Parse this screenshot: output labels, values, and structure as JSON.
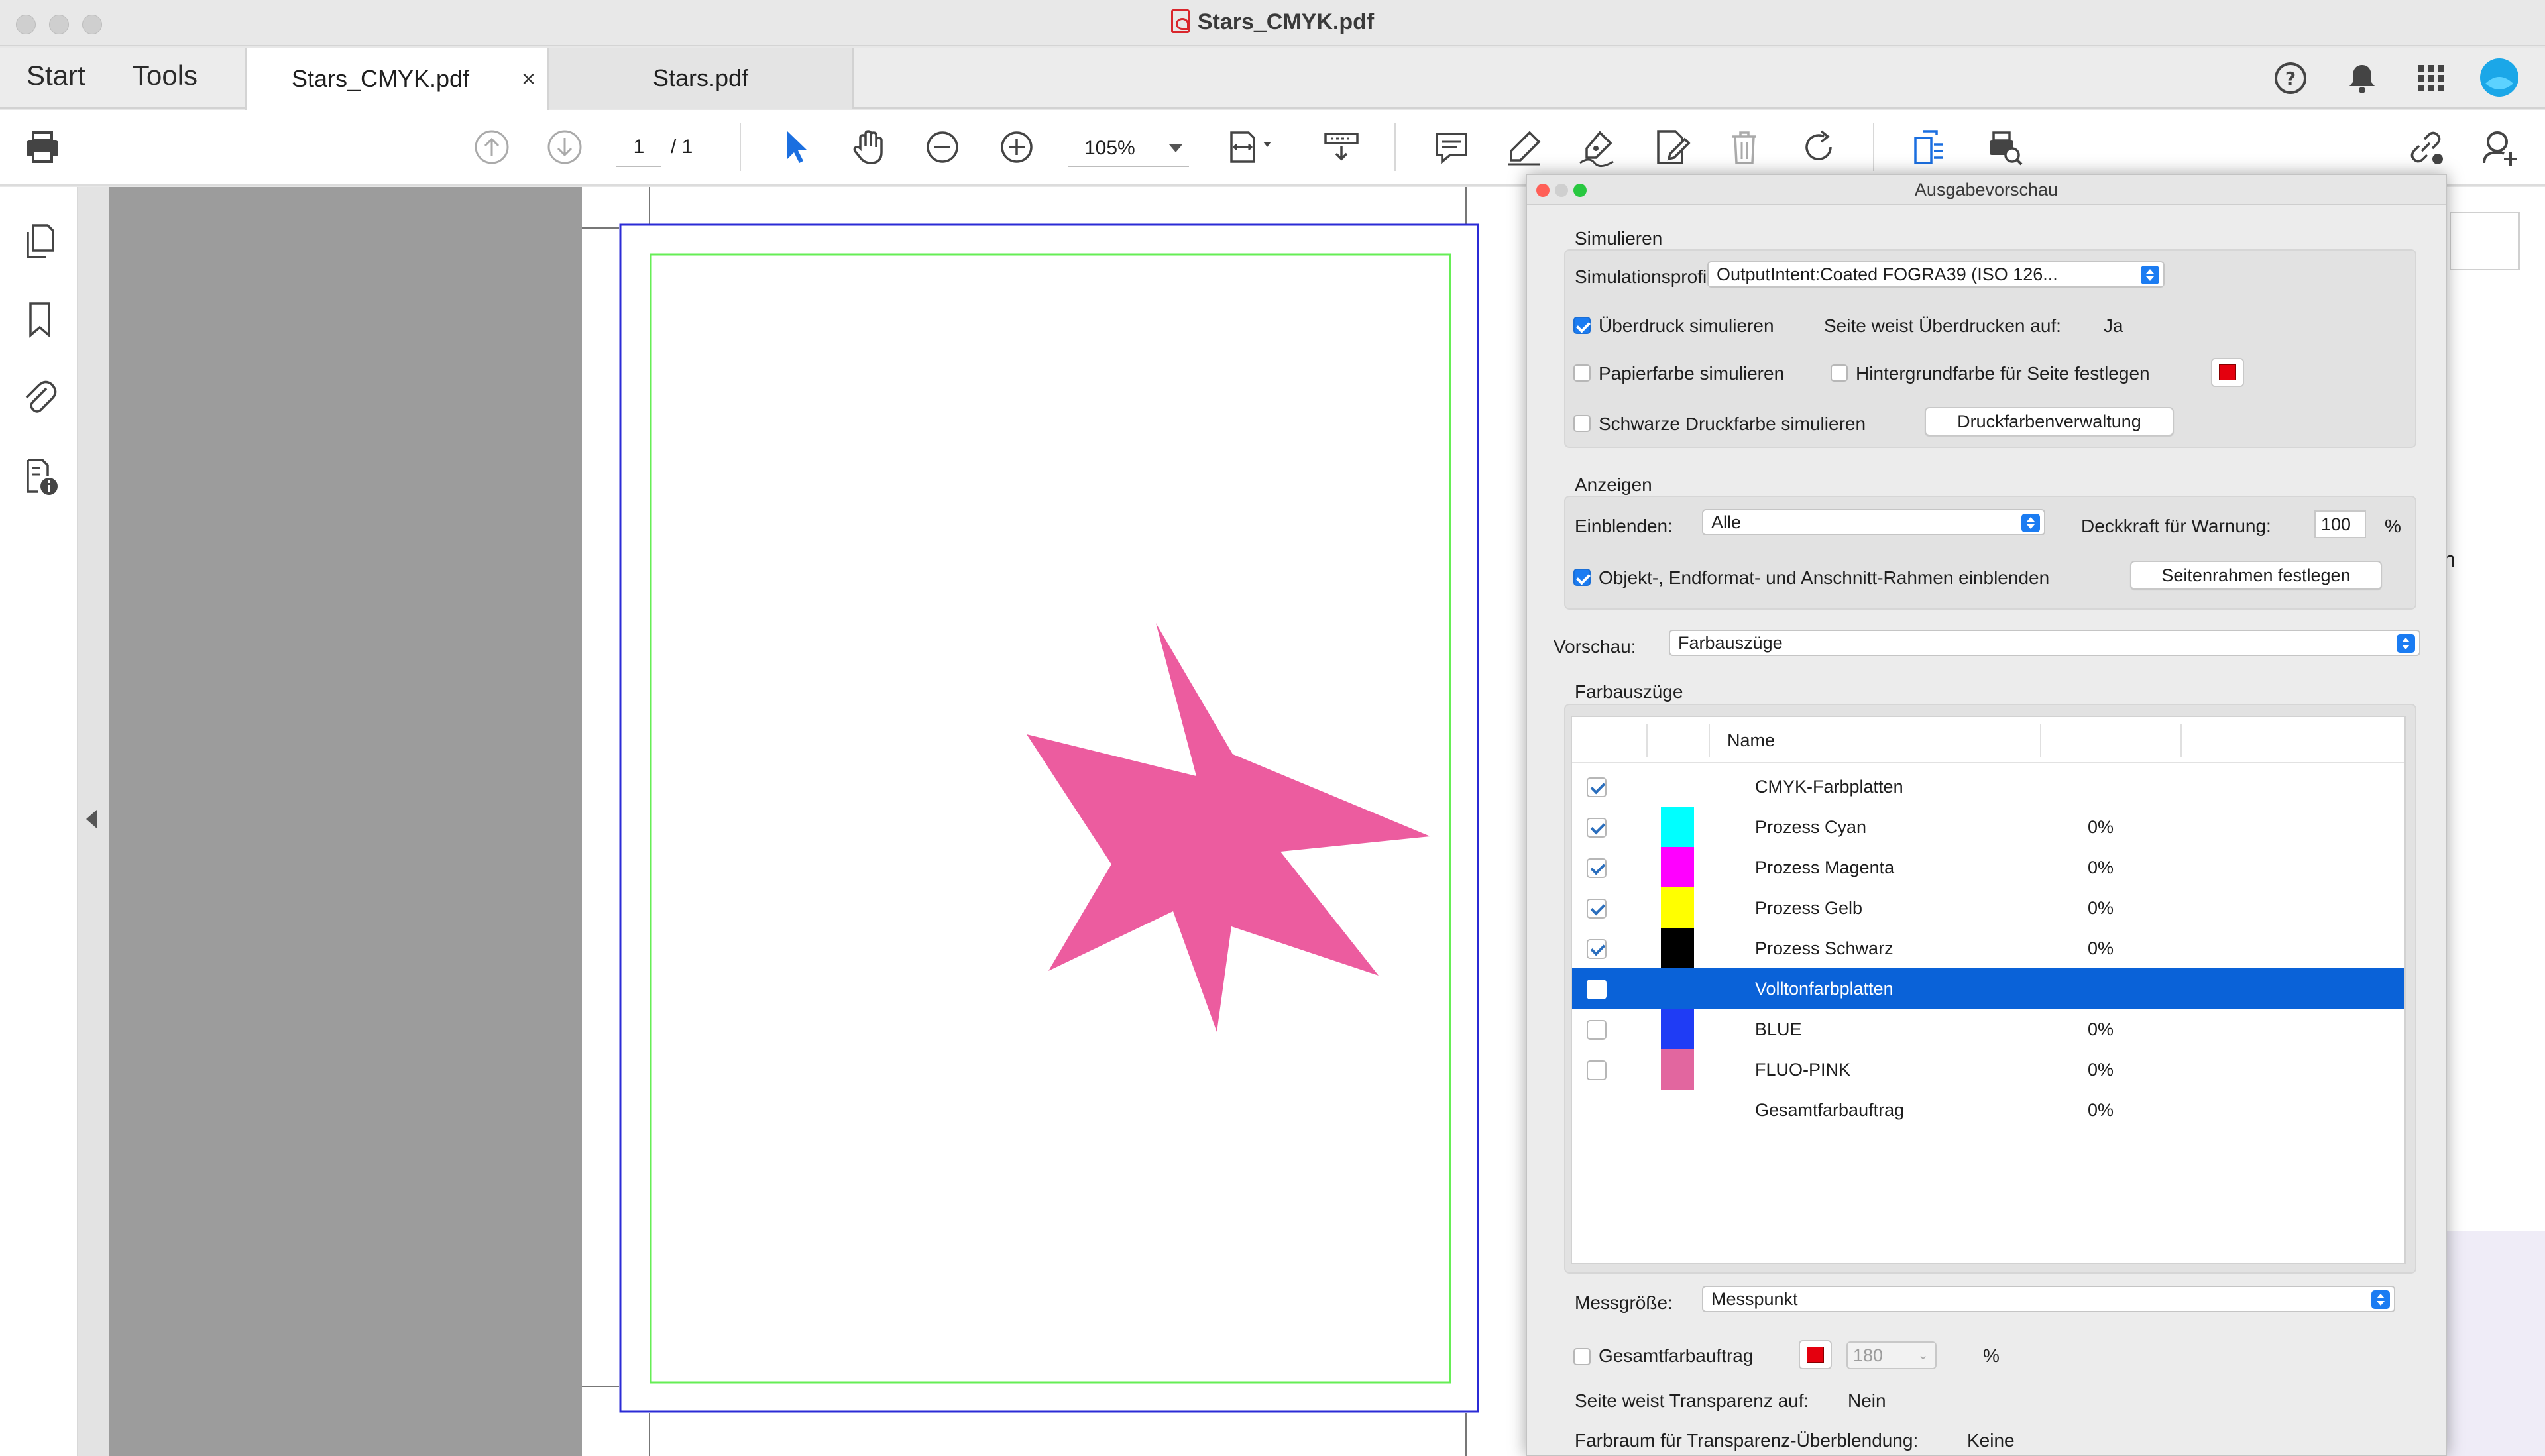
{
  "window": {
    "title": "Stars_CMYK.pdf"
  },
  "nav": {
    "start": "Start",
    "tools": "Tools"
  },
  "tabs": [
    {
      "label": "Stars_CMYK.pdf",
      "active": true,
      "close": "×"
    },
    {
      "label": "Stars.pdf",
      "active": false
    }
  ],
  "toolbar": {
    "page_current": "1",
    "page_total": "/ 1",
    "zoom": "105%"
  },
  "colors": {
    "accent": "#1b7cf2",
    "selection": "#0a62d8",
    "star": "#ec5c9f",
    "trim_box": "#2b2bd6",
    "bleed_box": "#66ee55"
  },
  "panel": {
    "title": "Ausgabevorschau",
    "simulieren": {
      "heading": "Simulieren",
      "profile_label": "Simulationsprofil:",
      "profile_value": "OutputIntent:Coated FOGRA39 (ISO 126...",
      "overprint": {
        "label": "Überdruck simulieren",
        "checked": true
      },
      "overprint_info_label": "Seite weist Überdrucken auf:",
      "overprint_info_value": "Ja",
      "paper": {
        "label": "Papierfarbe simulieren",
        "checked": false
      },
      "background": {
        "label": "Hintergrundfarbe für Seite festlegen",
        "checked": false
      },
      "black_ink": {
        "label": "Schwarze Druckfarbe simulieren",
        "checked": false
      },
      "ink_manager_button": "Druckfarbenverwaltung"
    },
    "anzeigen": {
      "heading": "Anzeigen",
      "show_label": "Einblenden:",
      "show_value": "Alle",
      "opacity_label": "Deckkraft für Warnung:",
      "opacity_value": "100",
      "opacity_unit": "%",
      "boxes": {
        "label": "Objekt-, Endformat- und Anschnitt-Rahmen einblenden",
        "checked": true
      },
      "page_boxes_button": "Seitenrahmen festlegen"
    },
    "vorschau": {
      "label": "Vorschau:",
      "value": "Farbauszüge"
    },
    "farbauszuege": {
      "heading": "Farbauszüge",
      "column_name": "Name",
      "rows": [
        {
          "name": "CMYK-Farbplatten",
          "value": "",
          "checked": true,
          "swatch": "",
          "selected": false
        },
        {
          "name": "Prozess Cyan",
          "value": "0%",
          "checked": true,
          "swatch": "#00ffff",
          "selected": false
        },
        {
          "name": "Prozess Magenta",
          "value": "0%",
          "checked": true,
          "swatch": "#ff00ff",
          "selected": false
        },
        {
          "name": "Prozess Gelb",
          "value": "0%",
          "checked": true,
          "swatch": "#ffff00",
          "selected": false
        },
        {
          "name": "Prozess Schwarz",
          "value": "0%",
          "checked": true,
          "swatch": "#000000",
          "selected": false
        },
        {
          "name": "Volltonfarbplatten",
          "value": "",
          "checked": false,
          "swatch": "",
          "selected": true
        },
        {
          "name": "BLUE",
          "value": "0%",
          "checked": false,
          "swatch": "#1f3cf5",
          "selected": false
        },
        {
          "name": "FLUO-PINK",
          "value": "0%",
          "checked": false,
          "swatch": "#e2669f",
          "selected": false
        },
        {
          "name": "Gesamtfarbauftrag",
          "value": "0%",
          "checked": false,
          "swatch": "",
          "selected": false,
          "no_checkbox": true
        }
      ]
    },
    "messgroesse": {
      "label": "Messgröße:",
      "value": "Messpunkt"
    },
    "total_ink": {
      "label": "Gesamtfarbauftrag",
      "checked": false,
      "value": "180",
      "unit": "%"
    },
    "transparency_label": "Seite weist Transparenz auf:",
    "transparency_value": "Nein",
    "blend_space_label": "Farbraum für Transparenz-Überblendung:",
    "blend_space_value": "Keine"
  }
}
